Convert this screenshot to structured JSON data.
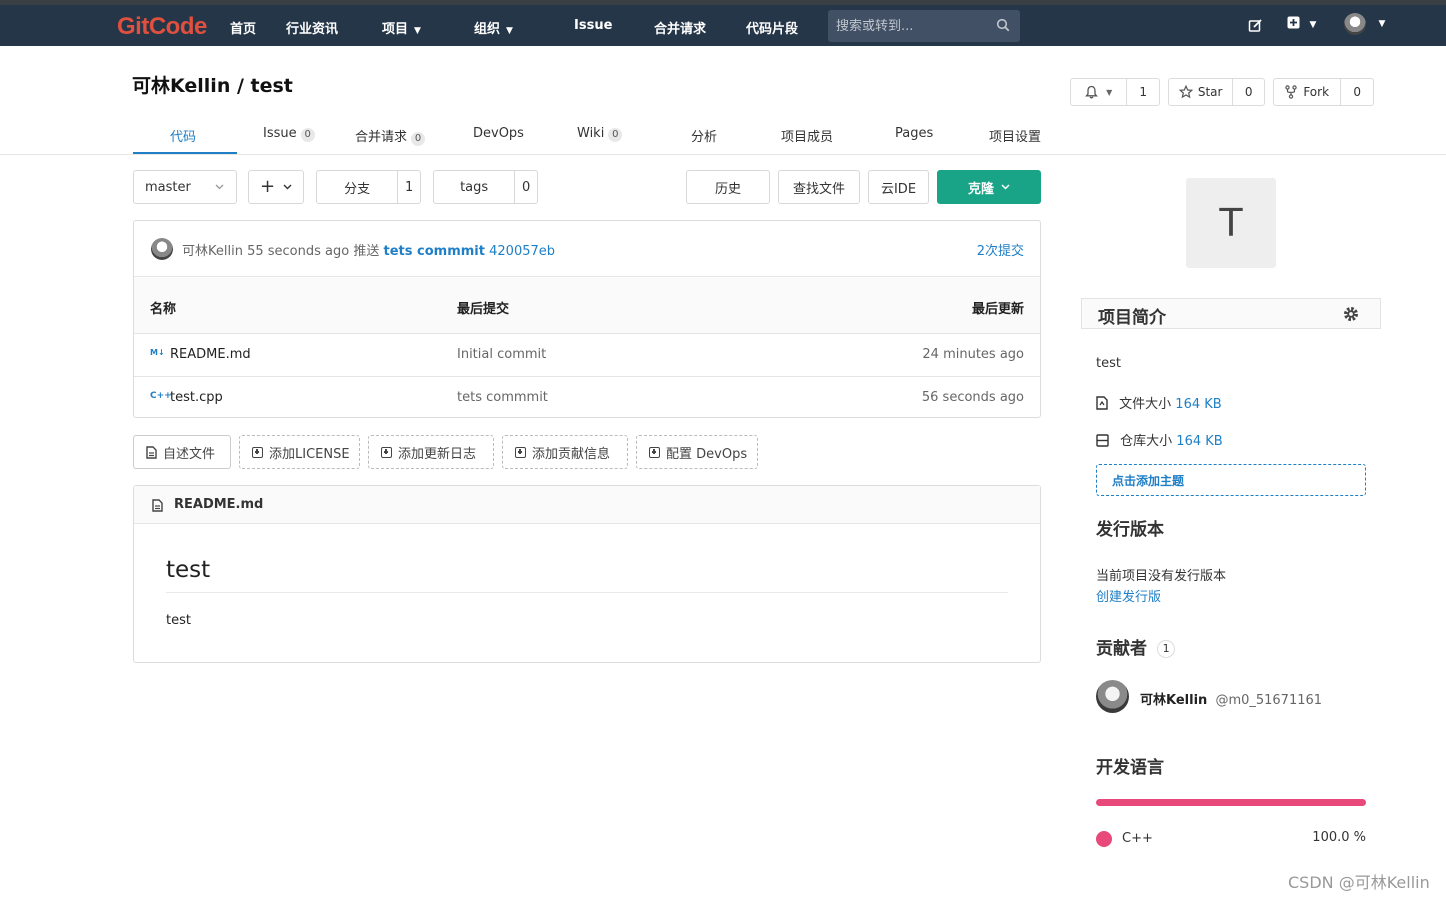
{
  "topnav": {
    "logo": "GitCode",
    "items": [
      "首页",
      "行业资讯",
      "项目",
      "组织",
      "Issue",
      "合并请求",
      "代码片段"
    ],
    "search_placeholder": "搜索或转到..."
  },
  "project": {
    "title": "可林Kellin / test",
    "watch_count": "1",
    "star_label": "Star",
    "star_count": "0",
    "fork_label": "Fork",
    "fork_count": "0"
  },
  "tabs": [
    {
      "label": "代码",
      "count": ""
    },
    {
      "label": "Issue",
      "count": "0"
    },
    {
      "label": "合并请求",
      "count": "0"
    },
    {
      "label": "DevOps",
      "count": ""
    },
    {
      "label": "Wiki",
      "count": "0"
    },
    {
      "label": "分析",
      "count": ""
    },
    {
      "label": "项目成员",
      "count": ""
    },
    {
      "label": "Pages",
      "count": ""
    },
    {
      "label": "项目设置",
      "count": ""
    }
  ],
  "toolbar": {
    "branch": "master",
    "branches_label": "分支",
    "branches_count": "1",
    "tags_label": "tags",
    "tags_count": "0",
    "history": "历史",
    "find_file": "查找文件",
    "cloud_ide": "云IDE",
    "clone": "克隆"
  },
  "last_commit": {
    "author": "可林Kellin",
    "time": "55 seconds ago",
    "action": "推送",
    "message": "tets commmit",
    "sha": "420057eb",
    "commits_link": "2次提交"
  },
  "file_table": {
    "headers": [
      "名称",
      "最后提交",
      "最后更新"
    ],
    "rows": [
      {
        "icon": "M↓",
        "name": "README.md",
        "commit": "Initial commit",
        "updated": "24 minutes ago"
      },
      {
        "icon": "C++",
        "name": "test.cpp",
        "commit": "tets commmit",
        "updated": "56 seconds ago"
      }
    ]
  },
  "quick_actions": [
    "自述文件",
    "添加LICENSE",
    "添加更新日志",
    "添加贡献信息",
    "配置 DevOps"
  ],
  "readme": {
    "filename": "README.md",
    "heading": "test",
    "body": "test"
  },
  "sidebar": {
    "avatar_letter": "T",
    "intro_title": "项目简介",
    "description": "test",
    "file_size_label": "文件大小",
    "file_size_value": "164 KB",
    "repo_size_label": "仓库大小",
    "repo_size_value": "164 KB",
    "add_topic": "点击添加主题",
    "releases_title": "发行版本",
    "no_release": "当前项目没有发行版本",
    "create_release": "创建发行版",
    "contributors_title": "贡献者",
    "contributors_count": "1",
    "contributor_name": "可林Kellin",
    "contributor_handle": "@m0_51671161",
    "languages_title": "开发语言",
    "language_name": "C++",
    "language_percent": "100.0 %",
    "language_share": 1.0
  },
  "watermark": "CSDN @可林Kellin",
  "colors": {
    "topbar": "#263649",
    "accent": "#1f7fc6",
    "clone": "#1aa487",
    "cpp": "#e8497a",
    "logo": "#e0503f"
  }
}
